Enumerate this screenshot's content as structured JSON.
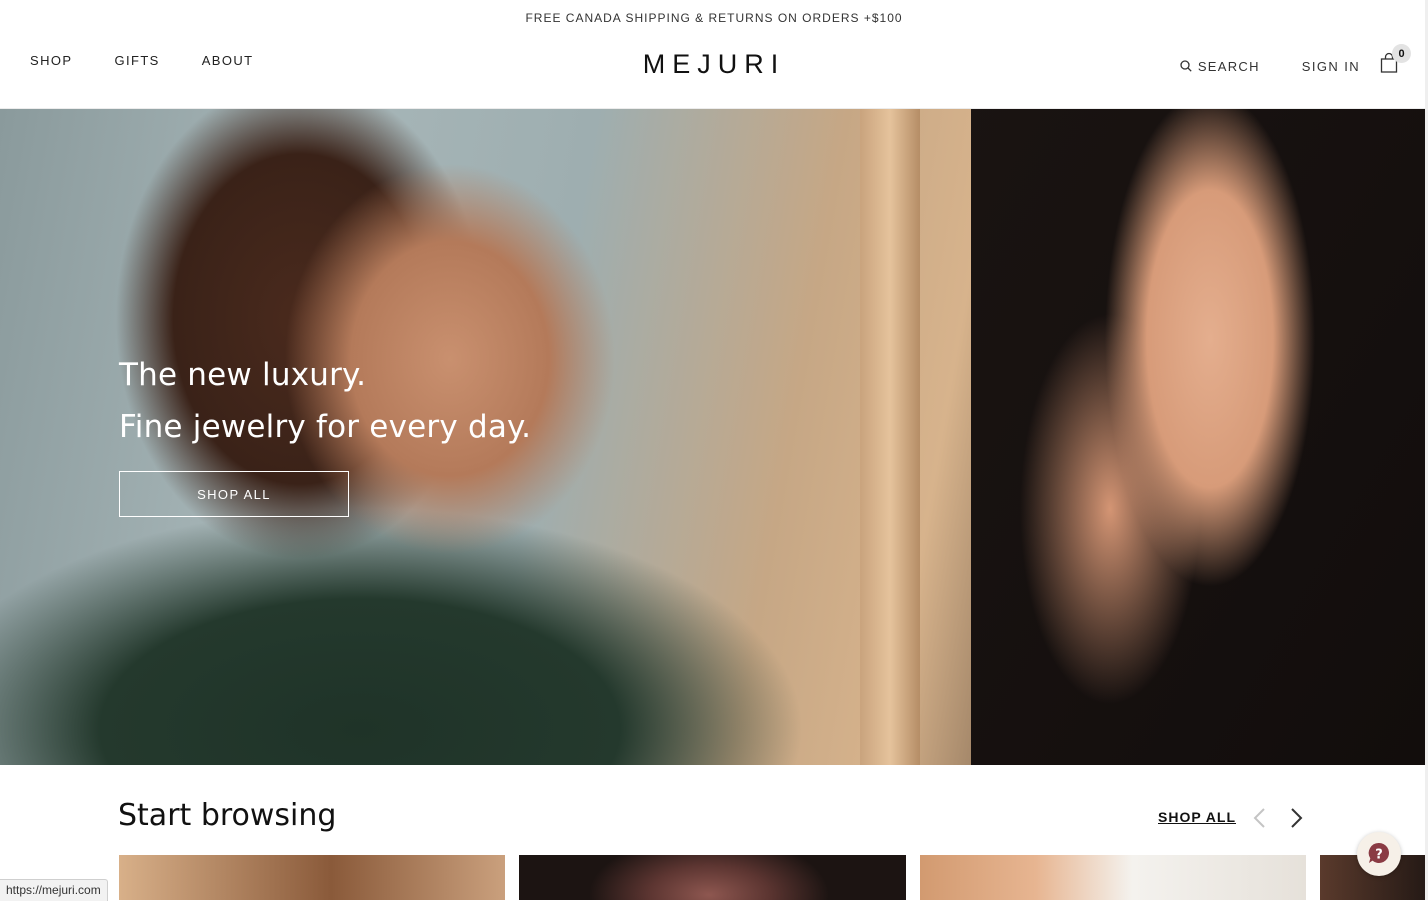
{
  "promo": {
    "text": "FREE CANADA SHIPPING & RETURNS ON ORDERS +$100"
  },
  "nav": {
    "left": [
      "SHOP",
      "GIFTS",
      "ABOUT"
    ],
    "logo": "MEJURI",
    "search_label": "SEARCH",
    "signin_label": "SIGN IN",
    "cart_count": "0"
  },
  "hero": {
    "line1": "The new luxury.",
    "line2": "Fine jewelry for every day.",
    "cta": "SHOP ALL"
  },
  "browse": {
    "title": "Start browsing",
    "shop_all": "SHOP ALL"
  },
  "status_bar": {
    "url": "https://mejuri.com"
  },
  "colors": {
    "text": "#1a1a1a",
    "accent_underline": "#111111",
    "help_icon": "#8a3b44"
  }
}
